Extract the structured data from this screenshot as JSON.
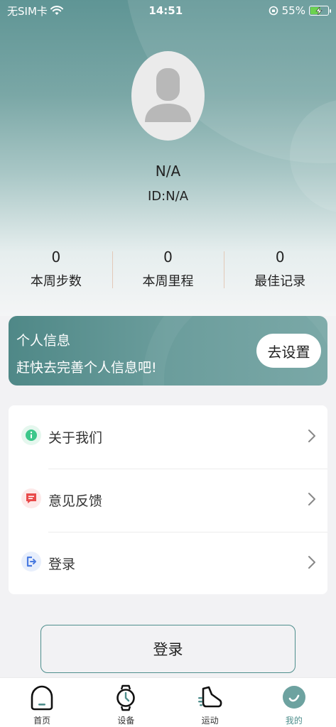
{
  "status_bar": {
    "carrier": "无SIM卡",
    "time": "14:51",
    "battery": "55%",
    "battery_level": 0.55
  },
  "profile": {
    "nickname": "N/A",
    "id": "ID:N/A"
  },
  "stats": [
    {
      "value": "0",
      "label": "本周步数"
    },
    {
      "value": "0",
      "label": "本周里程"
    },
    {
      "value": "0",
      "label": "最佳记录"
    }
  ],
  "banner": {
    "title": "个人信息",
    "subtitle": "赶快去完善个人信息吧!",
    "button": "去设置"
  },
  "menu": [
    {
      "label": "关于我们",
      "icon": "info-icon"
    },
    {
      "label": "意见反馈",
      "icon": "feedback-icon"
    },
    {
      "label": "登录",
      "icon": "login-icon"
    }
  ],
  "login_button": "登录",
  "tabs": [
    {
      "label": "首页",
      "icon": "home-icon",
      "active": false
    },
    {
      "label": "设备",
      "icon": "watch-icon",
      "active": false
    },
    {
      "label": "运动",
      "icon": "shoe-icon",
      "active": false
    },
    {
      "label": "我的",
      "icon": "profile-icon",
      "active": true
    }
  ],
  "colors": {
    "accent": "#4e8e8c",
    "info": "#3cc78a",
    "feedback": "#e94b4b",
    "login": "#4a7be0"
  }
}
